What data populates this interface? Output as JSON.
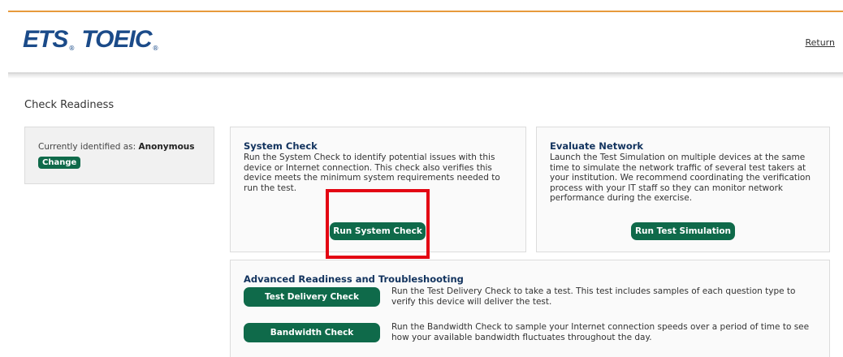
{
  "header": {
    "logo_ets": "ETS",
    "logo_toeic": "TOEIC",
    "logo_reg": "®",
    "return_label": "Return"
  },
  "page": {
    "title": "Check Readiness"
  },
  "identity": {
    "prefix": "Currently identified as:",
    "name": "Anonymous",
    "change_label": "Change"
  },
  "system_check": {
    "title": "System Check",
    "body": "Run the System Check to identify potential issues with this device or Internet connection. This check also verifies this device meets the minimum system requirements needed to run the test.",
    "button": "Run System Check"
  },
  "network": {
    "title": "Evaluate Network",
    "body": "Launch the Test Simulation on multiple devices at the same time to simulate the network traffic of several test takers at your institution. We recommend coordinating the verification process with your IT staff so they can monitor network performance during the exercise.",
    "button": "Run Test Simulation"
  },
  "advanced": {
    "title": "Advanced Readiness and Troubleshooting",
    "items": [
      {
        "button": "Test Delivery Check",
        "desc": "Run the Test Delivery Check to take a test. This test includes samples of each question type to verify this device will deliver the test."
      },
      {
        "button": "Bandwidth Check",
        "desc": "Run the Bandwidth Check to sample your Internet connection speeds over a period of time to see how your available bandwidth fluctuates throughout the day."
      }
    ]
  },
  "colors": {
    "accent_orange": "#e79a3c",
    "button_green": "#0f6a4a",
    "title_blue": "#12335e",
    "highlight_red": "#e30613"
  }
}
